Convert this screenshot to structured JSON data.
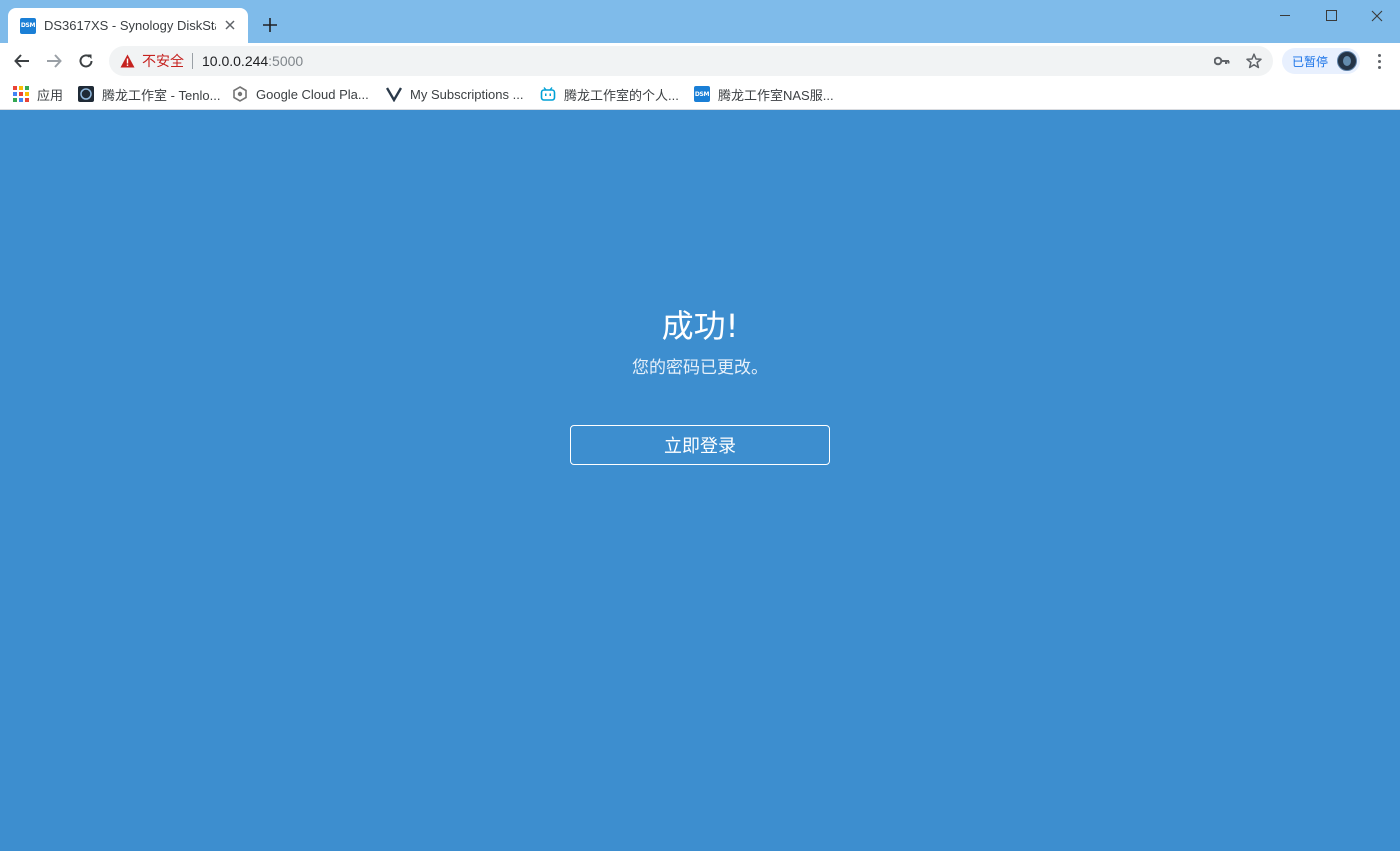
{
  "browser": {
    "tab": {
      "favicon_text": "DSM",
      "title": "DS3617XS - Synology DiskStation"
    },
    "address": {
      "security_label": "不安全",
      "host": "10.0.0.244",
      "port": ":5000"
    },
    "profile": {
      "status_label": "已暂停"
    },
    "bookmarks": [
      {
        "label": "应用",
        "icon": "apps-grid-icon"
      },
      {
        "label": "腾龙工作室 - Tenlo...",
        "icon": "tenlong-logo-icon"
      },
      {
        "label": "Google Cloud Pla...",
        "icon": "gcp-hexagon-icon"
      },
      {
        "label": "My Subscriptions ...",
        "icon": "v-logo-icon"
      },
      {
        "label": "腾龙工作室的个人...",
        "icon": "bilibili-icon"
      },
      {
        "label": "腾龙工作室NAS服...",
        "icon": "dsm-icon"
      }
    ],
    "bookmark_dsm_text": "DSM"
  },
  "page": {
    "title": "成功!",
    "message": "您的密码已更改。",
    "login_button": "立即登录"
  },
  "colors": {
    "page_background": "#3d8ecf",
    "tabbar_background": "#7fbbea",
    "insecure_red": "#c5221f",
    "accent_blue": "#1a73e8"
  }
}
